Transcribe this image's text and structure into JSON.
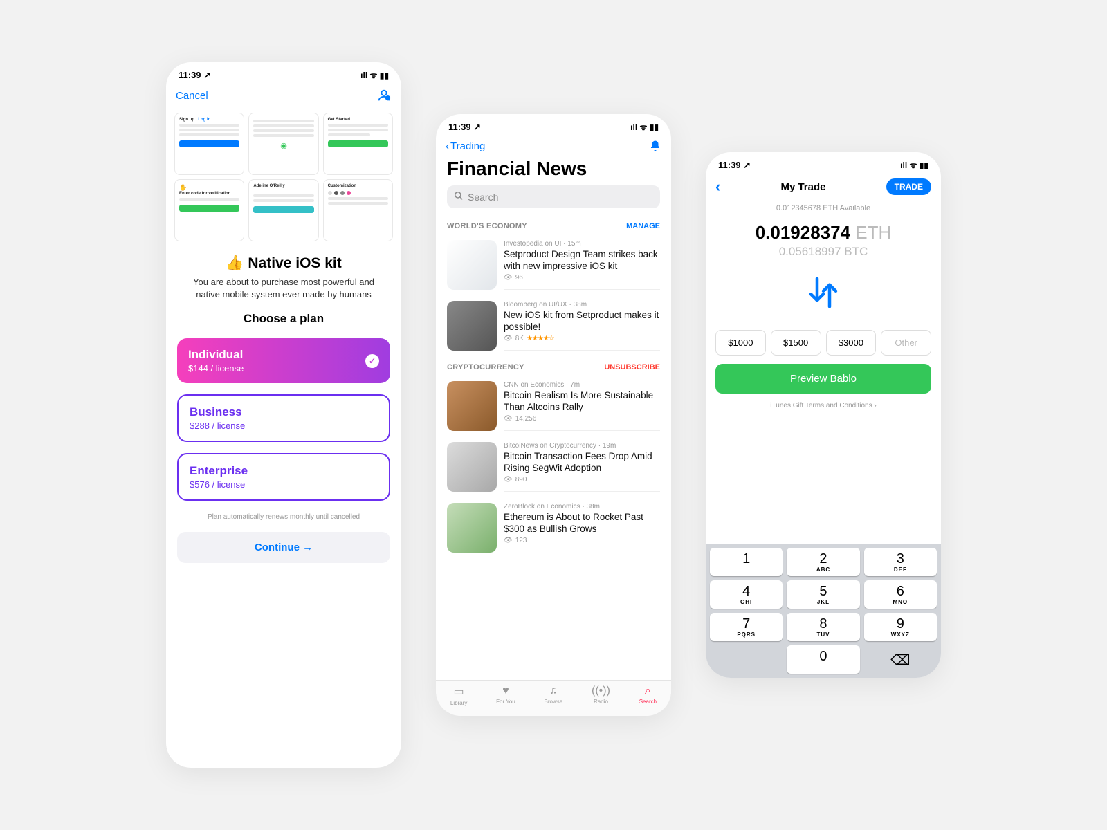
{
  "status": {
    "time": "11:39",
    "signal": "••ıl",
    "wifi": "◗",
    "battery": "▮▮▯"
  },
  "screen1": {
    "cancel": "Cancel",
    "title": "Native iOS kit",
    "subtitle": "You are about to purchase most powerful and native mobile system ever made by humans",
    "choose": "Choose a plan",
    "plans": [
      {
        "name": "Individual",
        "price": "$144 / license",
        "selected": true
      },
      {
        "name": "Business",
        "price": "$288 / license",
        "selected": false
      },
      {
        "name": "Enterprise",
        "price": "$576 / license",
        "selected": false
      }
    ],
    "fine_print": "Plan automatically renews monthly until cancelled",
    "continue": "Continue →",
    "mini_labels": {
      "signup": "Sign up",
      "login": "Log in",
      "get_started": "Get Started",
      "verify": "Enter code for verification",
      "customization": "Customization"
    }
  },
  "screen2": {
    "back": "Trading",
    "title": "Financial News",
    "search_placeholder": "Search",
    "sections": [
      {
        "label": "WORLD'S ECONOMY",
        "action": "MANAGE",
        "action_color": "#007aff"
      },
      {
        "label": "CRYPTOCURRENCY",
        "action": "UNSUBSCRIBE",
        "action_color": "#ff3b30"
      }
    ],
    "articles": [
      {
        "meta": "Investopedia on UI · 15m",
        "title": "Setproduct Design Team strikes back with new impressive iOS kit",
        "views": "96",
        "stars": ""
      },
      {
        "meta": "Bloomberg on UI/UX · 38m",
        "title": "New iOS kit from Setproduct makes it possible!",
        "views": "8K",
        "stars": "★★★★☆"
      },
      {
        "meta": "CNN on Economics · 7m",
        "title": "Bitcoin Realism Is More Sustainable Than Altcoins Rally",
        "views": "14,256",
        "stars": ""
      },
      {
        "meta": "BitcoiNews on Cryptocurrency · 19m",
        "title": "Bitcoin Transaction Fees Drop Amid Rising SegWit Adoption",
        "views": "890",
        "stars": ""
      },
      {
        "meta": "ZeroBlock on Economics · 38m",
        "title": "Ethereum is About to Rocket Past $300 as Bullish Grows",
        "views": "123",
        "stars": ""
      }
    ],
    "tabs": [
      {
        "label": "Library"
      },
      {
        "label": "For You"
      },
      {
        "label": "Browse"
      },
      {
        "label": "Radio"
      },
      {
        "label": "Search"
      }
    ]
  },
  "screen3": {
    "title": "My Trade",
    "trade_btn": "TRADE",
    "available": "0.012345678 ETH Available",
    "amount_main": "0.01928374",
    "amount_unit": "ETH",
    "amount_sub": "0.05618997 BTC",
    "chips": [
      "$1000",
      "$1500",
      "$3000",
      "Other"
    ],
    "preview": "Preview Bablo",
    "terms": "iTunes Gift Terms and Conditions",
    "keys": [
      {
        "n": "1",
        "s": ""
      },
      {
        "n": "2",
        "s": "ABC"
      },
      {
        "n": "3",
        "s": "DEF"
      },
      {
        "n": "4",
        "s": "GHI"
      },
      {
        "n": "5",
        "s": "JKL"
      },
      {
        "n": "6",
        "s": "MNO"
      },
      {
        "n": "7",
        "s": "PQRS"
      },
      {
        "n": "8",
        "s": "TUV"
      },
      {
        "n": "9",
        "s": "WXYZ"
      },
      {
        "n": "",
        "s": ""
      },
      {
        "n": "0",
        "s": ""
      },
      {
        "n": "⌫",
        "s": ""
      }
    ]
  }
}
